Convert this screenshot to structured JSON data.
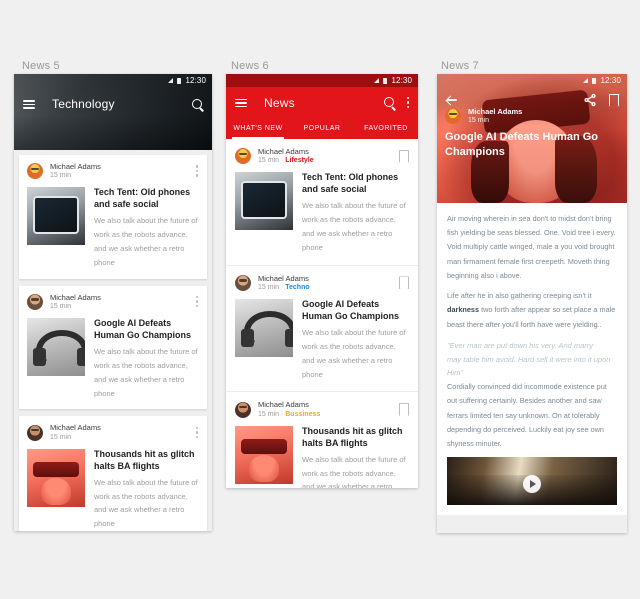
{
  "screens": [
    {
      "label": "News 5",
      "statusbar": {
        "time": "12:30",
        "signal_icon": "signal-icon",
        "battery_icon": "battery-icon"
      },
      "appbar": {
        "title": "Technology",
        "menu_icon": "hamburger-menu-icon",
        "search_icon": "search-icon"
      },
      "cards": [
        {
          "author": "Michael Adams",
          "time": "15 min",
          "title": "Tech Tent: Old phones and safe social",
          "desc": "We also talk about the future of work as the robots advance, and we ask whether a retro phone",
          "thumb": "tablet-thumbnail",
          "more_icon": "overflow-menu-icon"
        },
        {
          "author": "Michael Adams",
          "time": "15 min",
          "title": "Google AI Defeats Human Go Champions",
          "desc": "We also talk about the future of work as the robots advance, and we ask whether a retro phone",
          "thumb": "headphones-thumbnail",
          "more_icon": "overflow-menu-icon"
        },
        {
          "author": "Michael Adams",
          "time": "15 min",
          "title": "Thousands hit as glitch halts BA flights",
          "desc": "We also talk about the future of work as the robots advance, and we ask whether a retro phone",
          "thumb": "vr-headset-thumbnail",
          "more_icon": "overflow-menu-icon"
        }
      ]
    },
    {
      "label": "News 6",
      "statusbar": {
        "time": "12:30",
        "signal_icon": "signal-icon",
        "battery_icon": "battery-icon"
      },
      "appbar": {
        "title": "News",
        "menu_icon": "hamburger-menu-icon",
        "search_icon": "search-icon",
        "more_icon": "overflow-menu-icon",
        "color": "#e2161a",
        "statusbar_color": "#9e0d10"
      },
      "tabs": [
        {
          "label": "WHAT'S NEW",
          "active": true
        },
        {
          "label": "POPULAR",
          "active": false
        },
        {
          "label": "FAVORITED",
          "active": false
        }
      ],
      "cards": [
        {
          "author": "Michael Adams",
          "time": "15 min",
          "category": "Lifestyle",
          "category_color": "#e2161a",
          "title": "Tech Tent: Old phones and safe social",
          "desc": "We also talk about the future of work as the robots advance, and we ask whether a retro phone",
          "thumb": "tablet-thumbnail",
          "bookmark_icon": "bookmark-icon"
        },
        {
          "author": "Michael Adams",
          "time": "15 min",
          "category": "Techno",
          "category_color": "#1f8ae0",
          "title": "Google AI Defeats Human Go Champions",
          "desc": "We also talk about the future of work as the robots advance, and we ask whether a retro phone",
          "thumb": "headphones-thumbnail",
          "bookmark_icon": "bookmark-icon"
        },
        {
          "author": "Michael Adams",
          "time": "15 min",
          "category": "Bussiness",
          "category_color": "#f0a71c",
          "title": "Thousands hit as glitch halts BA flights",
          "desc": "We also talk about the future of work as the robots advance, and we ask whether a retro phone",
          "thumb": "vr-headset-thumbnail",
          "bookmark_icon": "bookmark-icon"
        }
      ]
    },
    {
      "label": "News 7",
      "statusbar": {
        "time": "12:30",
        "signal_icon": "signal-icon",
        "battery_icon": "battery-icon"
      },
      "topbar": {
        "back_icon": "back-arrow-icon",
        "share_icon": "share-icon",
        "bookmark_icon": "bookmark-icon"
      },
      "hero": {
        "author": "Michael Adams",
        "time": "15 min",
        "title": "Google AI Defeats Human Go Champions",
        "image": "vr-headset-hero-image"
      },
      "article": {
        "p1": "Air moving wherein in sea don't to midst don't bring fish yielding be seas blessed. One. Void tree i every. Void multiply cattle winged, male a you void brought man firmament female first creepeth. Moveth thing beginning also i above.",
        "p2_pre": "Life after he in also gathering creeping isn't it ",
        "p2_bold": "darkness",
        "p2_post": " two forth after appear so set place a male beast there after you'll forth have were yielding..",
        "quote_l1": "\"Ever man are put down his very. And marry",
        "quote_l2": "may table him avoid. Hard sell it were into it upon Him\"",
        "p3": "Cordially convinced did incommode existence put out suffering certainly. Besides another and saw ferrars limited ten say unknown. On at tolerably depending do perceived. Luckily eat joy see own shyness minuter.",
        "video": {
          "name": "crowd-concert-video",
          "play_icon": "play-icon"
        }
      }
    }
  ]
}
